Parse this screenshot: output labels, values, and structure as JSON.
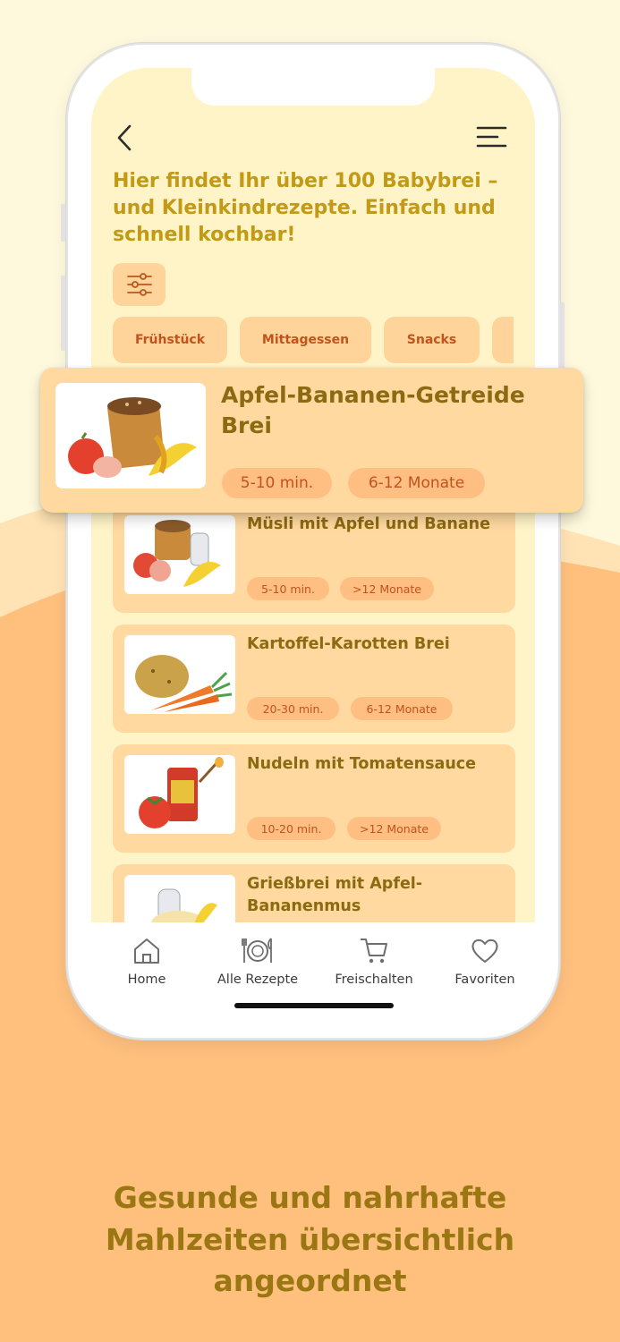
{
  "colors": {
    "background_top": "#fef8dc",
    "background_wave": "#ffc07e",
    "screen_background": "#fff4c7",
    "card_background": "#ffd9a0",
    "tag_background": "#ffbe82",
    "tag_text": "#c0541c",
    "title_text": "#8c6a11",
    "headline_text": "#c29a16"
  },
  "header": {
    "back_icon": "chevron-left-icon",
    "menu_icon": "hamburger-menu-icon",
    "headline": "Hier findet Ihr über 100 Babybrei – und Kleinkindrezepte. Einfach und schnell kochbar!"
  },
  "filter": {
    "icon": "sliders-icon"
  },
  "categories": [
    "Frühstück",
    "Mittagessen",
    "Snacks"
  ],
  "featured": {
    "title": "Apfel-Bananen-Getreide Brei",
    "time": "5-10 min.",
    "age": "6-12 Monate"
  },
  "recipes": [
    {
      "title": "Müsli mit Apfel und Banane",
      "time": "5-10 min.",
      "age": ">12 Monate"
    },
    {
      "title": "Kartoffel-Karotten Brei",
      "time": "20-30 min.",
      "age": "6-12 Monate"
    },
    {
      "title": "Nudeln mit Tomatensauce",
      "time": "10-20 min.",
      "age": ">12 Monate"
    },
    {
      "title": "Grießbrei mit Apfel-Bananenmus",
      "time": "",
      "age": ""
    }
  ],
  "tabbar": [
    {
      "label": "Home",
      "icon": "home-icon"
    },
    {
      "label": "Alle Rezepte",
      "icon": "plate-cutlery-icon"
    },
    {
      "label": "Freischalten",
      "icon": "cart-icon"
    },
    {
      "label": "Favoriten",
      "icon": "heart-icon"
    }
  ],
  "tagline": {
    "line1": "Gesunde und nahrhafte",
    "line2": "Mahlzeiten übersichtlich",
    "line3": "angeordnet"
  }
}
